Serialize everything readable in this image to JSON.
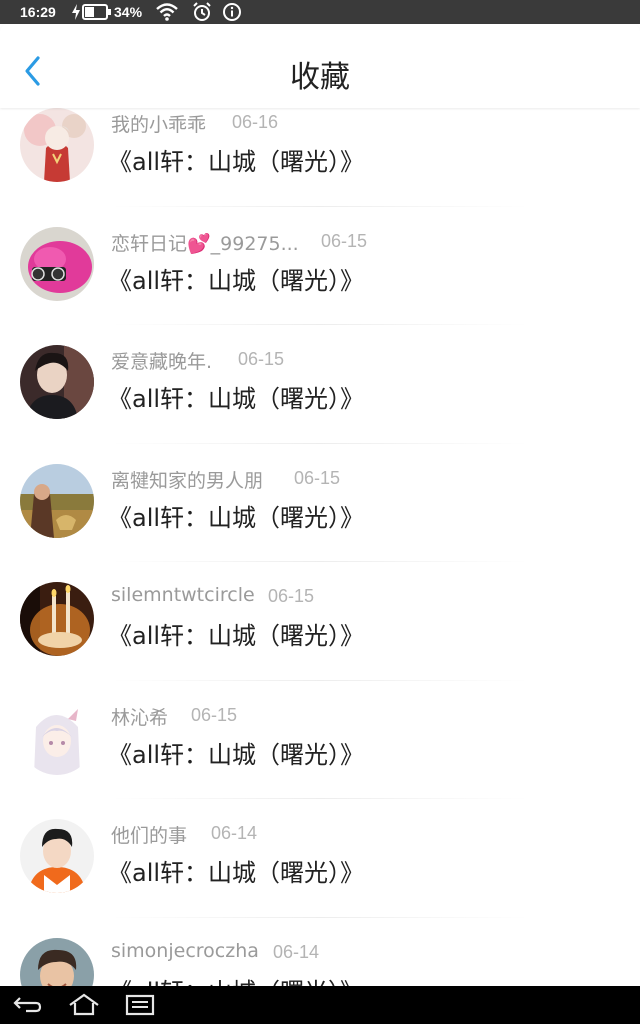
{
  "status_bar": {
    "time": "16:29",
    "battery_percent": "34%",
    "icons": [
      "charging-icon",
      "battery-icon",
      "wifi-icon",
      "alarm-icon",
      "info-icon"
    ]
  },
  "header": {
    "title": "收藏",
    "back_icon": "chevron-left-icon",
    "accent": "#2b9be4"
  },
  "favorites": [
    {
      "author": "我的小乖乖",
      "date": "06-16",
      "work": "《all轩：山城（曙光）》",
      "avatar": "avatar-red-anime"
    },
    {
      "author": "恋轩日记💕_99275...",
      "date": "06-15",
      "work": "《all轩：山城（曙光）》",
      "avatar": "avatar-pink-fluffy"
    },
    {
      "author": "爱意藏晚年.",
      "date": "06-15",
      "work": "《all轩：山城（曙光）》",
      "avatar": "avatar-dark-portrait"
    },
    {
      "author": "离犍知家的男人朋",
      "date": "06-15",
      "work": "《all轩：山城（曙光）》",
      "avatar": "avatar-landscape"
    },
    {
      "author": "silemntwtcircle",
      "date": "06-15",
      "work": "《all轩：山城（曙光）》",
      "avatar": "avatar-candles"
    },
    {
      "author": "林沁希",
      "date": "06-15",
      "work": "《all轩：山城（曙光）》",
      "avatar": "avatar-anime-white-hair"
    },
    {
      "author": "他们的事",
      "date": "06-14",
      "work": "《all轩：山城（曙光）》",
      "avatar": "avatar-boy-orange"
    },
    {
      "author": "simonjecroczha",
      "date": "06-14",
      "work": "《all轩：山城（曙光）》",
      "avatar": "avatar-boy-smiling"
    }
  ],
  "nav_bar": {
    "back_icon": "nav-back-icon",
    "home_icon": "nav-home-icon",
    "menu_icon": "nav-menu-icon"
  }
}
